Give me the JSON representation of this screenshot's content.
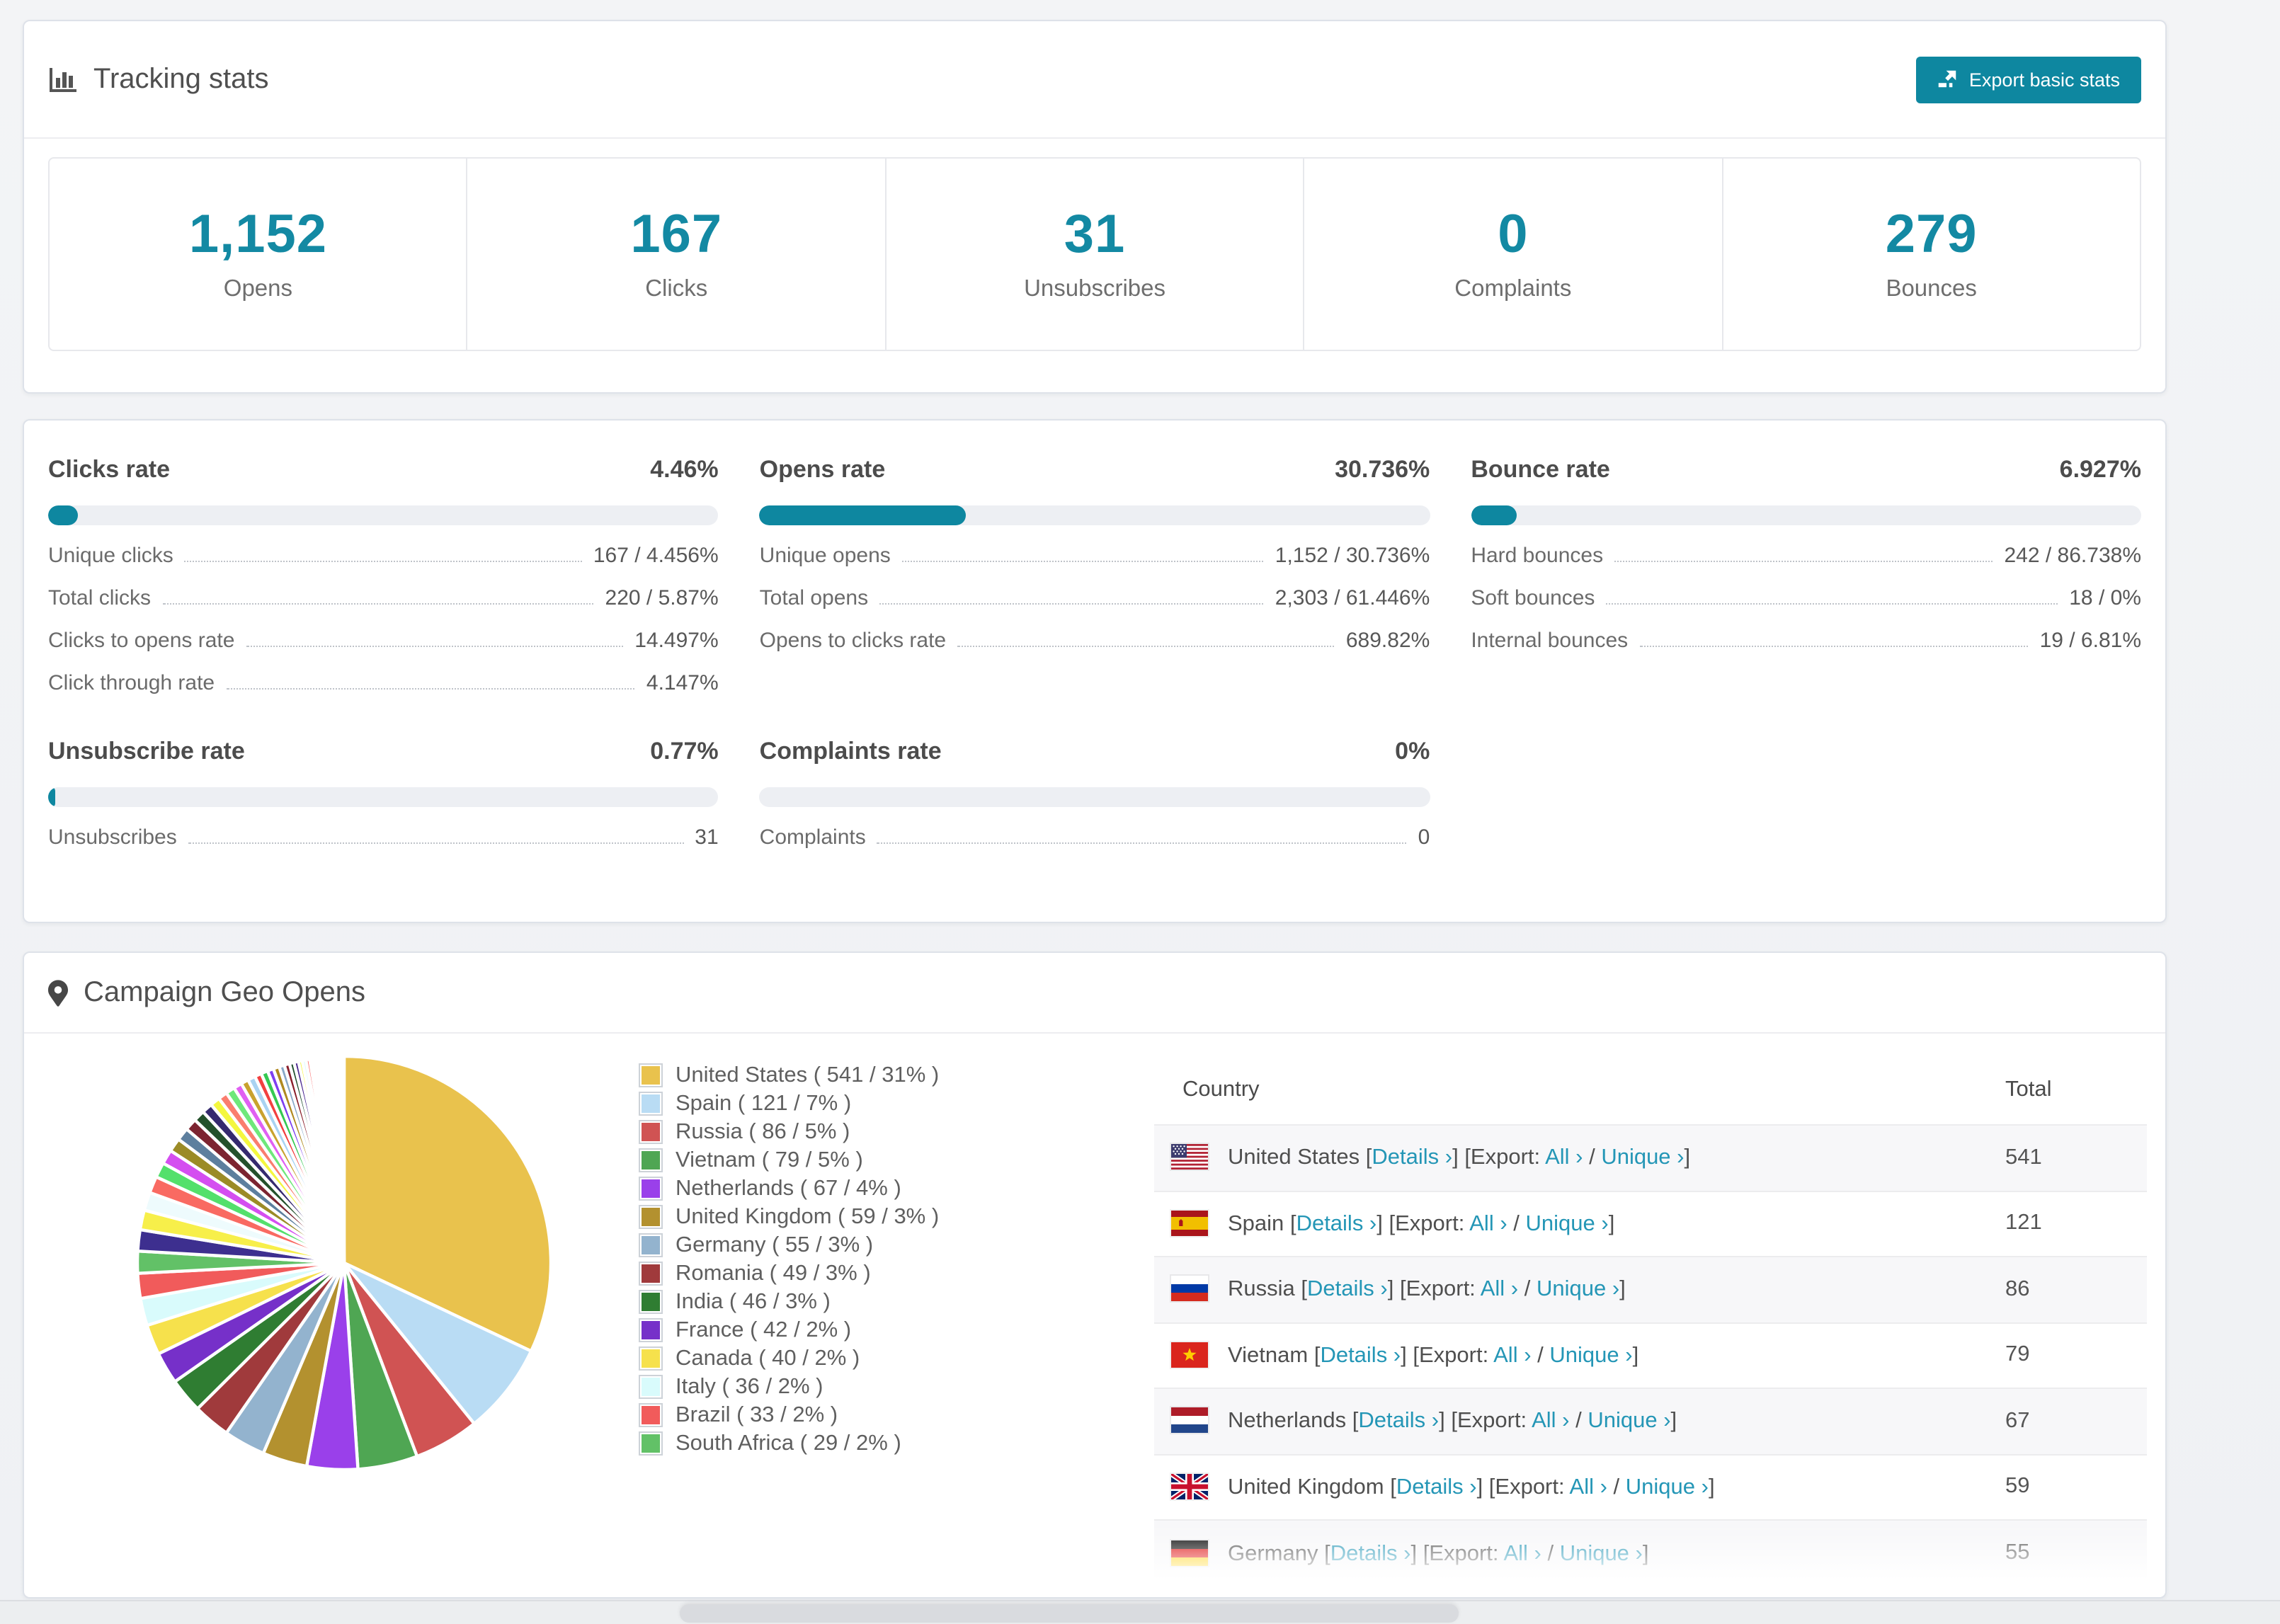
{
  "accent_color": "#0e87a0",
  "link_color": "#2496b6",
  "tracking": {
    "title": "Tracking stats",
    "export_label": "Export basic stats",
    "stats": [
      {
        "value": "1,152",
        "label": "Opens"
      },
      {
        "value": "167",
        "label": "Clicks"
      },
      {
        "value": "31",
        "label": "Unsubscribes"
      },
      {
        "value": "0",
        "label": "Complaints"
      },
      {
        "value": "279",
        "label": "Bounces"
      }
    ]
  },
  "rates": {
    "blocks": [
      {
        "title": "Clicks rate",
        "value": "4.46%",
        "pct": 4.46,
        "rows": [
          {
            "label": "Unique clicks",
            "value": "167 / 4.456%"
          },
          {
            "label": "Total clicks",
            "value": "220 / 5.87%"
          },
          {
            "label": "Clicks to opens rate",
            "value": "14.497%"
          },
          {
            "label": "Click through rate",
            "value": "4.147%"
          }
        ]
      },
      {
        "title": "Opens rate",
        "value": "30.736%",
        "pct": 30.736,
        "rows": [
          {
            "label": "Unique opens",
            "value": "1,152 / 30.736%"
          },
          {
            "label": "Total opens",
            "value": "2,303 / 61.446%"
          },
          {
            "label": "Opens to clicks rate",
            "value": "689.82%"
          }
        ]
      },
      {
        "title": "Bounce rate",
        "value": "6.927%",
        "pct": 6.927,
        "rows": [
          {
            "label": "Hard bounces",
            "value": "242 / 86.738%"
          },
          {
            "label": "Soft bounces",
            "value": "18 / 0%"
          },
          {
            "label": "Internal bounces",
            "value": "19 / 6.81%"
          }
        ]
      },
      {
        "title": "Unsubscribe rate",
        "value": "0.77%",
        "pct": 0.77,
        "rows": [
          {
            "label": "Unsubscribes",
            "value": "31"
          }
        ]
      },
      {
        "title": "Complaints rate",
        "value": "0%",
        "pct": 0,
        "rows": [
          {
            "label": "Complaints",
            "value": "0"
          }
        ]
      }
    ]
  },
  "geo": {
    "title": "Campaign Geo Opens",
    "link_labels": {
      "details": "Details",
      "export": "Export:",
      "all": "All",
      "unique": "Unique",
      "chevron": "›"
    },
    "table": {
      "headers": [
        "Country",
        "Total"
      ],
      "rows": [
        {
          "country": "United States",
          "flag": "us",
          "total": "541"
        },
        {
          "country": "Spain",
          "flag": "es",
          "total": "121"
        },
        {
          "country": "Russia",
          "flag": "ru",
          "total": "86"
        },
        {
          "country": "Vietnam",
          "flag": "vn",
          "total": "79"
        },
        {
          "country": "Netherlands",
          "flag": "nl",
          "total": "67"
        },
        {
          "country": "United Kingdom",
          "flag": "gb",
          "total": "59"
        },
        {
          "country": "Germany",
          "flag": "de",
          "total": "55"
        }
      ]
    }
  },
  "chart_data": {
    "type": "pie",
    "title": "Campaign Geo Opens",
    "legend_position": "right",
    "start_angle": "top",
    "direction": "clockwise",
    "categories": [
      "United States",
      "Spain",
      "Russia",
      "Vietnam",
      "Netherlands",
      "United Kingdom",
      "Germany",
      "Romania",
      "India",
      "France",
      "Canada",
      "Italy",
      "Brazil",
      "South Africa"
    ],
    "values": [
      541,
      121,
      86,
      79,
      67,
      59,
      55,
      49,
      46,
      42,
      40,
      36,
      33,
      29
    ],
    "percent_labels": [
      "31%",
      "7%",
      "5%",
      "5%",
      "4%",
      "3%",
      "3%",
      "3%",
      "3%",
      "2%",
      "2%",
      "2%",
      "2%",
      "2%"
    ],
    "colors": [
      "#e9c24d",
      "#b9dcf4",
      "#d05353",
      "#4fa653",
      "#9a40ea",
      "#b3912f",
      "#93b3ce",
      "#a03a3c",
      "#2f7d32",
      "#7630c9",
      "#f6e14c",
      "#d9fbfc",
      "#f15b5b",
      "#62c167"
    ],
    "legend_labels": [
      "United States ( 541 / 31% )",
      "Spain ( 121 / 7% )",
      "Russia ( 86 / 5% )",
      "Vietnam ( 79 / 5% )",
      "Netherlands ( 67 / 4% )",
      "United Kingdom ( 59 / 3% )",
      "Germany ( 55 / 3% )",
      "Romania ( 49 / 3% )",
      "India ( 46 / 3% )",
      "France ( 42 / 2% )",
      "Canada ( 40 / 2% )",
      "Italy ( 36 / 2% )",
      "Brazil ( 33 / 2% )",
      "South Africa ( 29 / 2% )"
    ],
    "others": {
      "note": "long tail of small unlabeled countries rendered as thin slices",
      "values": [
        28,
        26,
        24,
        22,
        20,
        19,
        18,
        17,
        16,
        15,
        14,
        13,
        12,
        12,
        11,
        10,
        10,
        9,
        9,
        8,
        8,
        7,
        7,
        6,
        6,
        5,
        5,
        5,
        4,
        4,
        4,
        3,
        3,
        3,
        3,
        2,
        2,
        2,
        2,
        2,
        2,
        1,
        1,
        1,
        1,
        1,
        1,
        1,
        1,
        1
      ],
      "colors": [
        "#3d2f8f",
        "#f7ef4a",
        "#eefbfd",
        "#f96a62",
        "#53e06b",
        "#d44ef0",
        "#9b8b26",
        "#5d7f9e",
        "#7c2430",
        "#24512b",
        "#352a6e",
        "#f4f73f",
        "#fa7d6e",
        "#6ee87a",
        "#e060f2",
        "#c9a22e",
        "#a9d3f2",
        "#f24040",
        "#35c952",
        "#7d3ff0",
        "#b0891f",
        "#88a8c8",
        "#8a1f2b",
        "#1d4d2b",
        "#4c2a90",
        "#f5f542",
        "#d8fbff",
        "#fa6b6b",
        "#57f06b",
        "#c95bf0",
        "#8a7a22",
        "#6888a8",
        "#a93a3a",
        "#2f7d32",
        "#9b2fbe",
        "#f5e042",
        "#ccf7fa",
        "#ef5350",
        "#66bb6a",
        "#b478f0",
        "#d4b02f",
        "#90c8f0",
        "#e04848",
        "#40c060",
        "#8a50e0",
        "#c8b830",
        "#e8fcff",
        "#ff8080",
        "#70e880",
        "#d070f0"
      ]
    }
  }
}
